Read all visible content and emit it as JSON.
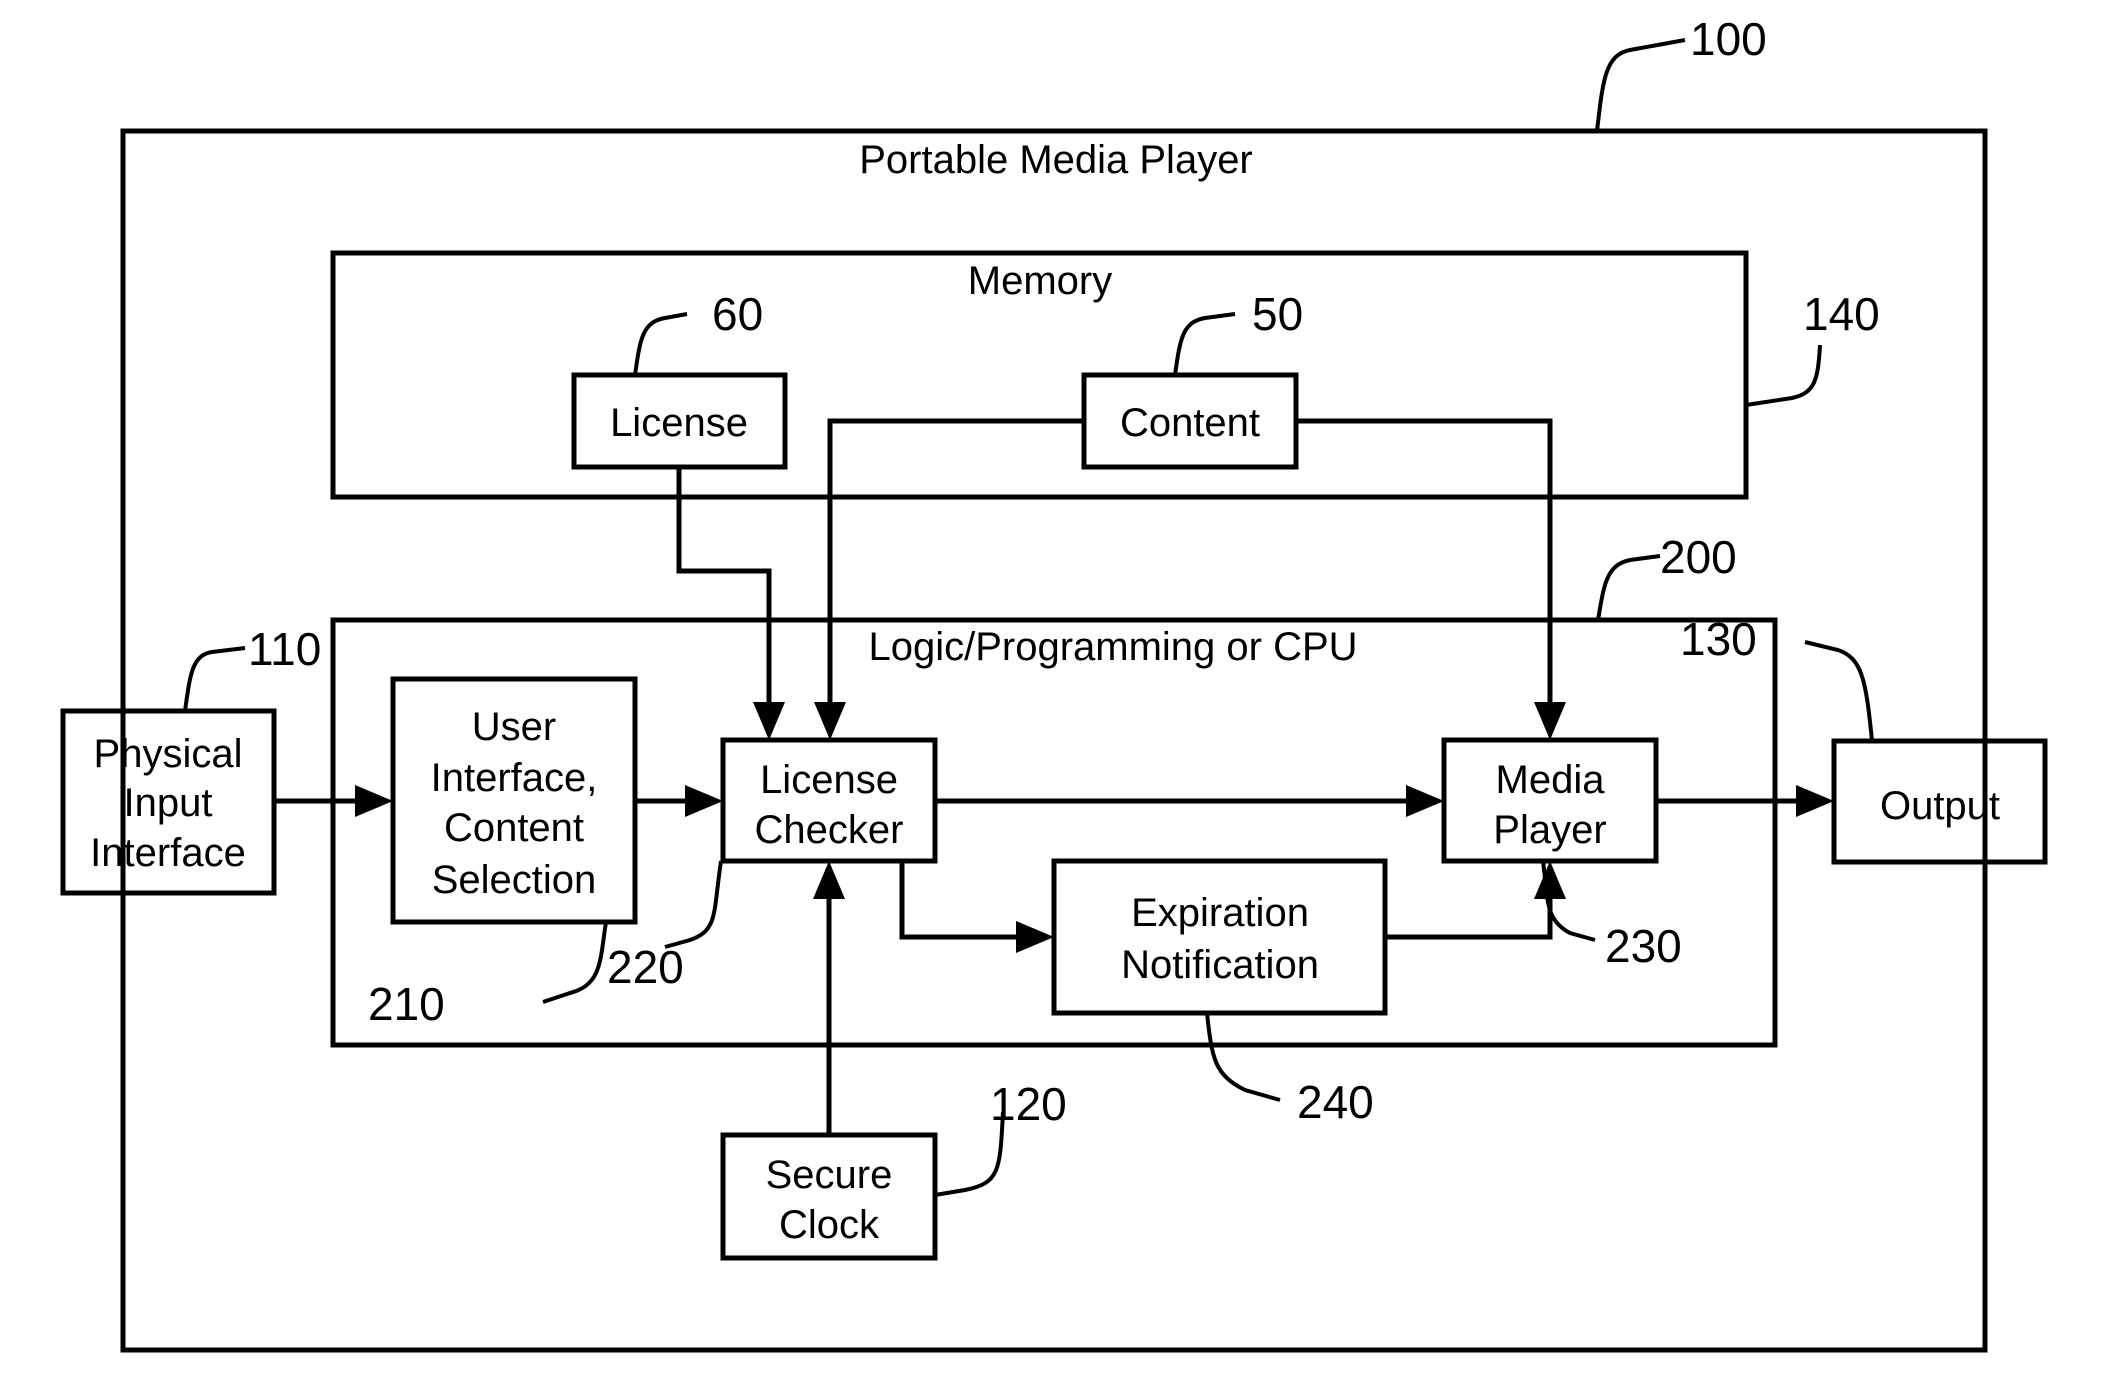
{
  "diagram": {
    "title": "Portable Media Player",
    "containers": {
      "outer": {
        "label": "Portable Media Player",
        "ref": "100"
      },
      "memory": {
        "label": "Memory",
        "ref": "140"
      },
      "logic": {
        "label": "Logic/Programming or CPU",
        "ref": "200"
      }
    },
    "blocks": {
      "license": {
        "lines": [
          "License"
        ],
        "ref": "60"
      },
      "content": {
        "lines": [
          "Content"
        ],
        "ref": "50"
      },
      "physical_input": {
        "lines": [
          "Physical",
          "Input",
          "Interface"
        ],
        "ref": "110"
      },
      "user_interface": {
        "lines": [
          "User",
          "Interface,",
          "Content",
          "Selection"
        ],
        "ref": "210"
      },
      "license_checker": {
        "lines": [
          "License",
          "Checker"
        ],
        "ref": "220"
      },
      "media_player": {
        "lines": [
          "Media",
          "Player"
        ],
        "ref": "230"
      },
      "output": {
        "lines": [
          "Output"
        ],
        "ref": "130"
      },
      "expiration": {
        "lines": [
          "Expiration",
          "Notification"
        ],
        "ref": "240"
      },
      "secure_clock": {
        "lines": [
          "Secure",
          "Clock"
        ],
        "ref": "120"
      }
    },
    "connections": [
      {
        "from": "physical_input",
        "to": "user_interface"
      },
      {
        "from": "user_interface",
        "to": "license_checker"
      },
      {
        "from": "license",
        "to": "license_checker"
      },
      {
        "from": "content",
        "to": "license_checker"
      },
      {
        "from": "content",
        "to": "media_player"
      },
      {
        "from": "license_checker",
        "to": "media_player"
      },
      {
        "from": "license_checker",
        "to": "expiration"
      },
      {
        "from": "expiration",
        "to": "media_player"
      },
      {
        "from": "secure_clock",
        "to": "license_checker"
      },
      {
        "from": "media_player",
        "to": "output"
      }
    ]
  }
}
